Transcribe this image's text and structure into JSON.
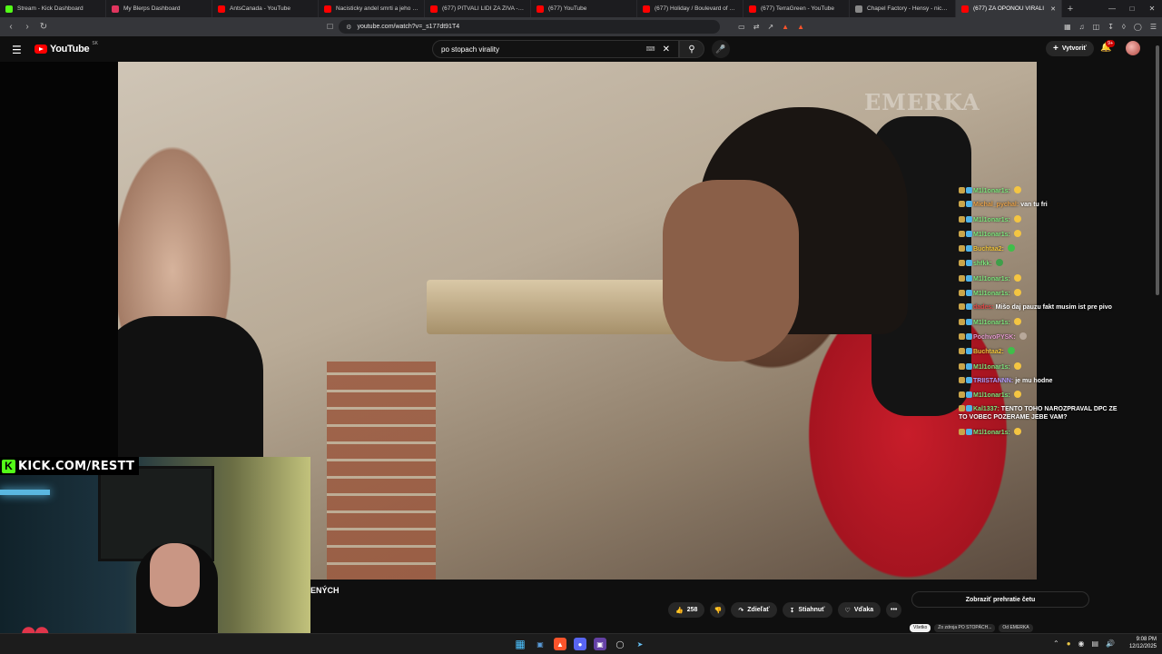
{
  "browser": {
    "tabs": [
      {
        "title": "Stream - Kick Dashboard",
        "fav": "#53fc18"
      },
      {
        "title": "My Blerps Dashboard",
        "fav": "#e0355e"
      },
      {
        "title": "AntsCanada - YouTube",
        "fav": "#ff0000"
      },
      {
        "title": "Nacisticky andel smrti a jeho strasli",
        "fav": "#ff0000"
      },
      {
        "title": "(677) PITVALI LIDI ZA ŽIVA - Jedno",
        "fav": "#ff0000"
      },
      {
        "title": "(677) YouTube",
        "fav": "#ff0000"
      },
      {
        "title": "(677) Holiday / Boulevard of Broke",
        "fav": "#ff0000"
      },
      {
        "title": "(677) TerraGreen - YouTube",
        "fav": "#ff0000"
      },
      {
        "title": "Chapel Factory - Hensy - niche pu",
        "fav": "#888888"
      },
      {
        "title": "(677) ZA OPONOU VIRALI",
        "fav": "#ff0000"
      }
    ],
    "active_tab_index": 9,
    "new_tab": "+",
    "url": "youtube.com/watch?v=_s177dt91T4"
  },
  "youtube": {
    "logo_text": "YouTube",
    "region": "SK",
    "search_query": "po stopach virality",
    "create_label": "Vytvoriť",
    "notif_count": "9+"
  },
  "video": {
    "watermark": "EMERKA",
    "partial_title": "ENÝCH"
  },
  "chat": [
    {
      "user": "M1l1onar1s:",
      "text": "",
      "color": "#7ee87e",
      "emoji": "#f4c542"
    },
    {
      "user": "Michal_pychal:",
      "text": "van tu fri",
      "color": "#e8a24a",
      "emoji": ""
    },
    {
      "user": "M1l1onar1s:",
      "text": "",
      "color": "#7ee87e",
      "emoji": "#f4c542"
    },
    {
      "user": "M1l1onar1s:",
      "text": "",
      "color": "#7ee87e",
      "emoji": "#f4c542"
    },
    {
      "user": "Buchtaa2:",
      "text": "",
      "color": "#f0c43a",
      "emoji": "#3fbf4a"
    },
    {
      "user": "shfkk:",
      "text": "",
      "color": "#7ee87e",
      "emoji": "#3f9f4a"
    },
    {
      "user": "M1l1onar1s:",
      "text": "",
      "color": "#7ee87e",
      "emoji": "#f4c542"
    },
    {
      "user": "M1l1onar1s:",
      "text": "",
      "color": "#7ee87e",
      "emoji": "#f4c542"
    },
    {
      "user": "dades:",
      "text": "Mišo daj pauzu fakt musim ist pre pivo",
      "color": "#e04848",
      "emoji": ""
    },
    {
      "user": "M1l1onar1s:",
      "text": "",
      "color": "#7ee87e",
      "emoji": "#f4c542"
    },
    {
      "user": "PochvoPYSK:",
      "text": "",
      "color": "#e69ad0",
      "emoji": "#b8a89a"
    },
    {
      "user": "Buchtaa2:",
      "text": "",
      "color": "#f0c43a",
      "emoji": "#3fbf4a"
    },
    {
      "user": "M1l1onar1s:",
      "text": "",
      "color": "#7ee87e",
      "emoji": "#f4c542"
    },
    {
      "user": "TRIISTANNN:",
      "text": "je mu hodne",
      "color": "#b59cff",
      "emoji": ""
    },
    {
      "user": "M1l1onar1s:",
      "text": "",
      "color": "#7ee87e",
      "emoji": "#f4c542"
    },
    {
      "user": "Kal1337:",
      "text": "TENTO TOHO NAROZPRAVAL DPC ZE TO VOBEC POZERAME JEBE VAM?",
      "color": "#7ee87e",
      "emoji": ""
    },
    {
      "user": "M1l1onar1s:",
      "text": "",
      "color": "#7ee87e",
      "emoji": "#f4c542"
    }
  ],
  "kick": {
    "logo_letter": "K",
    "url_text": "KICK.COM/RESTT"
  },
  "actions": {
    "likes": "258",
    "share": "Zdieľať",
    "download": "Stiahnuť",
    "thanks": "Vďaka",
    "more": "•••"
  },
  "replay_chat": "Zobraziť prehratie četu",
  "chips": [
    "Všetko",
    "Zo zdroja PO STOPÁCH...",
    "Od EMERKA"
  ],
  "taskbar": {
    "time": "9:08 PM",
    "date": "12/12/2025"
  },
  "icons": {
    "back": "back-icon",
    "forward": "forward-icon",
    "reload": "reload-icon",
    "bookmark": "bookmark-icon",
    "menu": "hamburger-icon",
    "search": "search-icon",
    "mic": "microphone-icon",
    "bell": "bell-icon",
    "like": "thumbs-up-icon",
    "dislike": "thumbs-down-icon",
    "share": "share-icon",
    "download": "download-icon",
    "thanks": "heart-icon",
    "windows": "windows-icon"
  }
}
